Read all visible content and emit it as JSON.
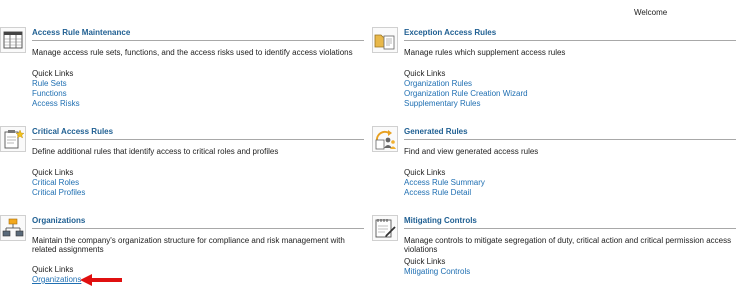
{
  "header": {
    "welcome": "Welcome"
  },
  "sections": [
    {
      "title": "Access Rule Maintenance",
      "description": "Manage access rule sets, functions, and the access risks used to identify access violations",
      "quick_links_label": "Quick Links",
      "links": [
        "Rule Sets",
        "Functions",
        "Access Risks"
      ],
      "icon": "table-icon"
    },
    {
      "title": "Exception Access Rules",
      "description": "Manage rules which supplement access rules",
      "quick_links_label": "Quick Links",
      "links": [
        "Organization Rules",
        "Organization Rule Creation Wizard",
        "Supplementary Rules"
      ],
      "icon": "folder-document-icon"
    },
    {
      "title": "Critical Access Rules",
      "description": "Define additional rules that identify access to critical roles and profiles",
      "quick_links_label": "Quick Links",
      "links": [
        "Critical Roles",
        "Critical Profiles"
      ],
      "icon": "clipboard-star-icon"
    },
    {
      "title": "Generated Rules",
      "description": "Find and view generated access rules",
      "quick_links_label": "Quick Links",
      "links": [
        "Access Rule Summary",
        "Access Rule Detail"
      ],
      "icon": "generate-users-icon"
    },
    {
      "title": "Organizations",
      "description": "Maintain the company's organization structure for compliance and risk management with related assignments",
      "quick_links_label": "Quick Links",
      "links": [
        "Organizations"
      ],
      "icon": "org-chart-icon"
    },
    {
      "title": "Mitigating Controls",
      "description": "Manage controls to mitigate segregation of duty, critical action and critical permission access violations",
      "quick_links_label": "Quick Links",
      "links": [
        "Mitigating Controls"
      ],
      "icon": "notepad-pen-icon"
    }
  ],
  "colors": {
    "title": "#1f5f92",
    "link": "#1f6fb2",
    "arrow": "#e01010"
  }
}
